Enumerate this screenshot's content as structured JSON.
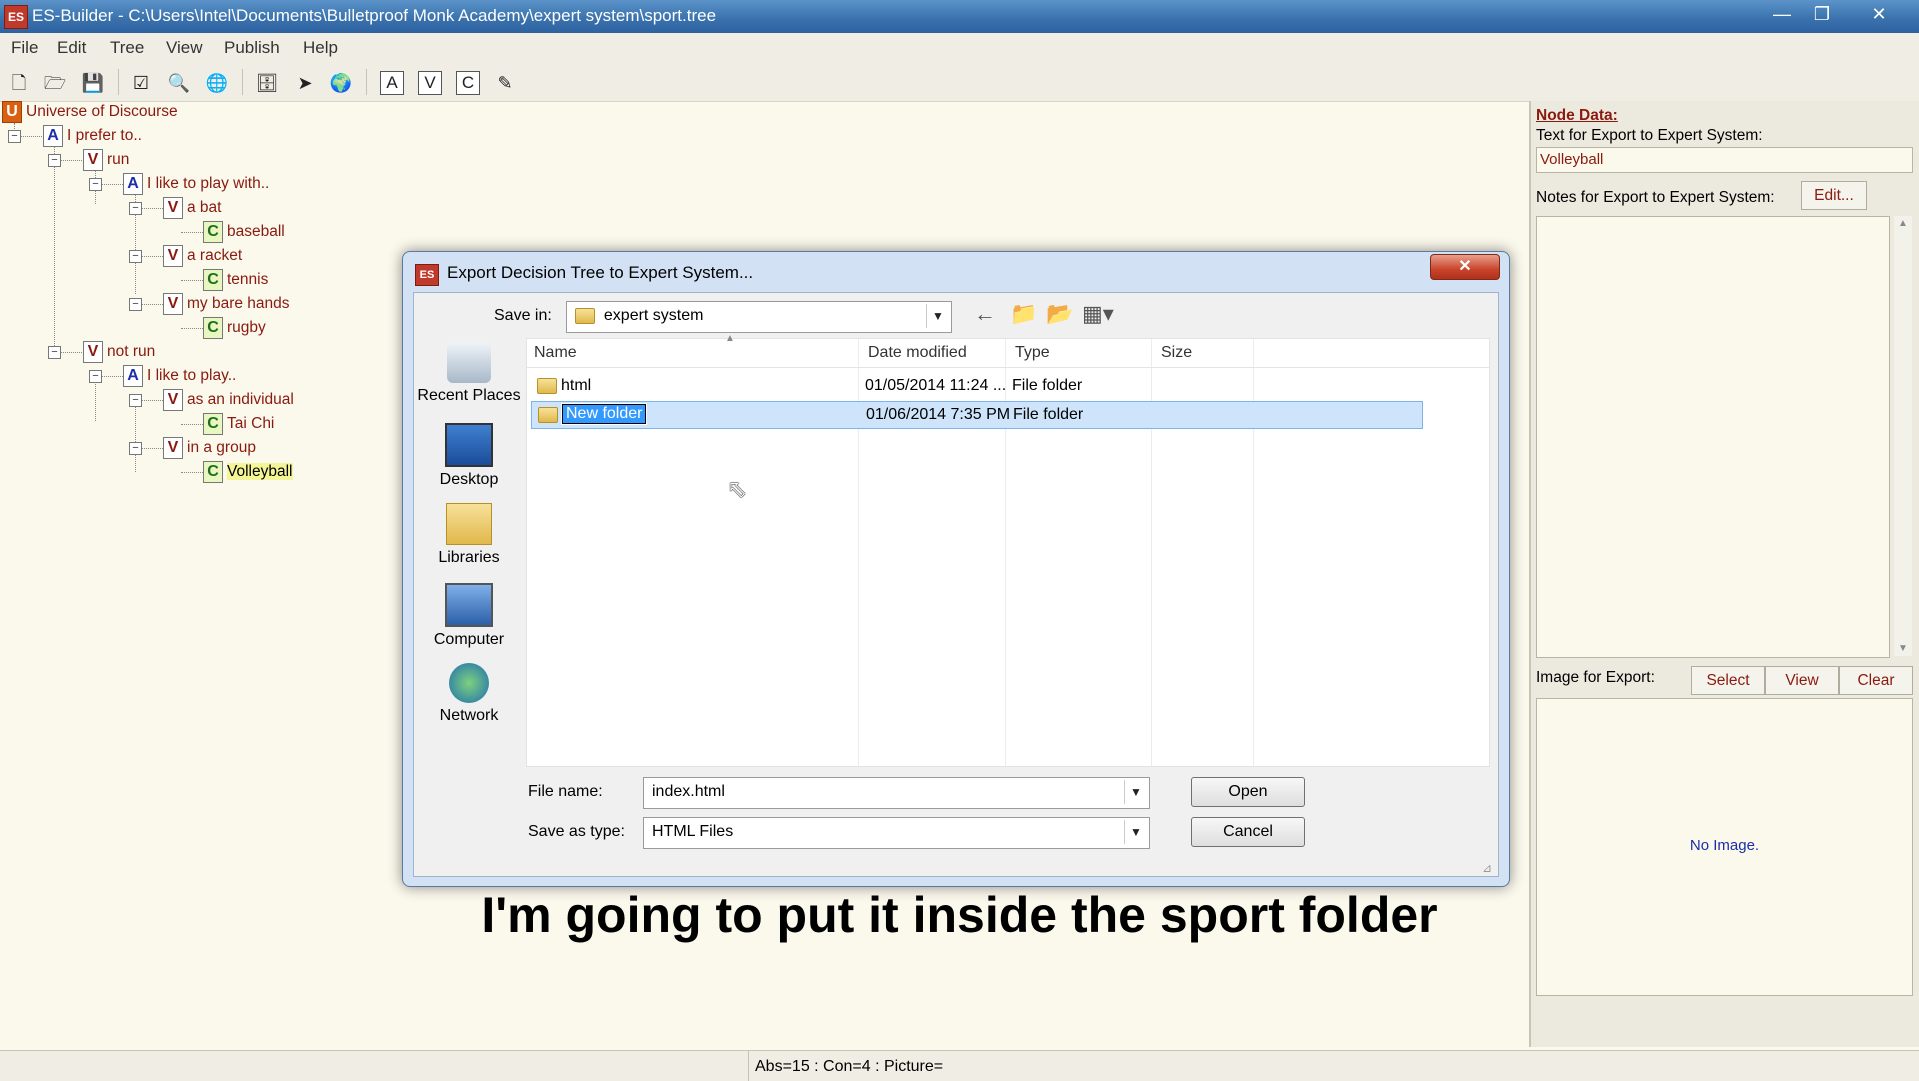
{
  "window": {
    "title": "ES-Builder - C:\\Users\\Intel\\Documents\\Bulletproof Monk Academy\\expert system\\sport.tree",
    "app_icon": "es-builder-icon"
  },
  "menu": [
    "File",
    "Edit",
    "Tree",
    "View",
    "Publish",
    "Help"
  ],
  "toolbar": {
    "letter_buttons": [
      "A",
      "V",
      "C"
    ]
  },
  "tree": {
    "root": "Universe of Discourse",
    "nodes": [
      {
        "type": "A",
        "label": "I prefer to.."
      },
      {
        "type": "V",
        "label": "run"
      },
      {
        "type": "A",
        "label": "I like to play with.."
      },
      {
        "type": "V",
        "label": "a bat"
      },
      {
        "type": "C",
        "label": "baseball"
      },
      {
        "type": "V",
        "label": "a racket"
      },
      {
        "type": "C",
        "label": "tennis"
      },
      {
        "type": "V",
        "label": "my bare hands"
      },
      {
        "type": "C",
        "label": "rugby"
      },
      {
        "type": "V",
        "label": "not run"
      },
      {
        "type": "A",
        "label": "I like to play.."
      },
      {
        "type": "V",
        "label": "as an individual"
      },
      {
        "type": "C",
        "label": "Tai Chi"
      },
      {
        "type": "V",
        "label": "in a group"
      },
      {
        "type": "C",
        "label": "Volleyball"
      }
    ]
  },
  "right_panel": {
    "node_data_title": "Node Data:",
    "text_export_label": "Text for Export to Expert System:",
    "text_export_value": "Volleyball",
    "notes_label": "Notes for Export to Expert System:",
    "edit_button": "Edit...",
    "image_label": "Image for Export:",
    "select_button": "Select",
    "view_button": "View",
    "clear_button": "Clear",
    "no_image": "No Image."
  },
  "status": "Abs=15 : Con=4 : Picture=",
  "dialog": {
    "title": "Export Decision Tree to Expert System...",
    "close": "✕",
    "save_in_label": "Save in:",
    "save_in_value": "expert system",
    "places": [
      "Recent Places",
      "Desktop",
      "Libraries",
      "Computer",
      "Network"
    ],
    "columns": [
      "Name",
      "Date modified",
      "Type",
      "Size"
    ],
    "files": [
      {
        "name": "html",
        "date": "01/05/2014 11:24 ...",
        "type": "File folder",
        "size": ""
      },
      {
        "name": "New folder",
        "date": "01/06/2014 7:35 PM",
        "type": "File folder",
        "size": ""
      }
    ],
    "file_name_label": "File name:",
    "file_name_value": "index.html",
    "save_type_label": "Save as type:",
    "save_type_value": "HTML Files",
    "open_button": "Open",
    "cancel_button": "Cancel"
  },
  "caption": "I'm going to put it inside the sport folder"
}
